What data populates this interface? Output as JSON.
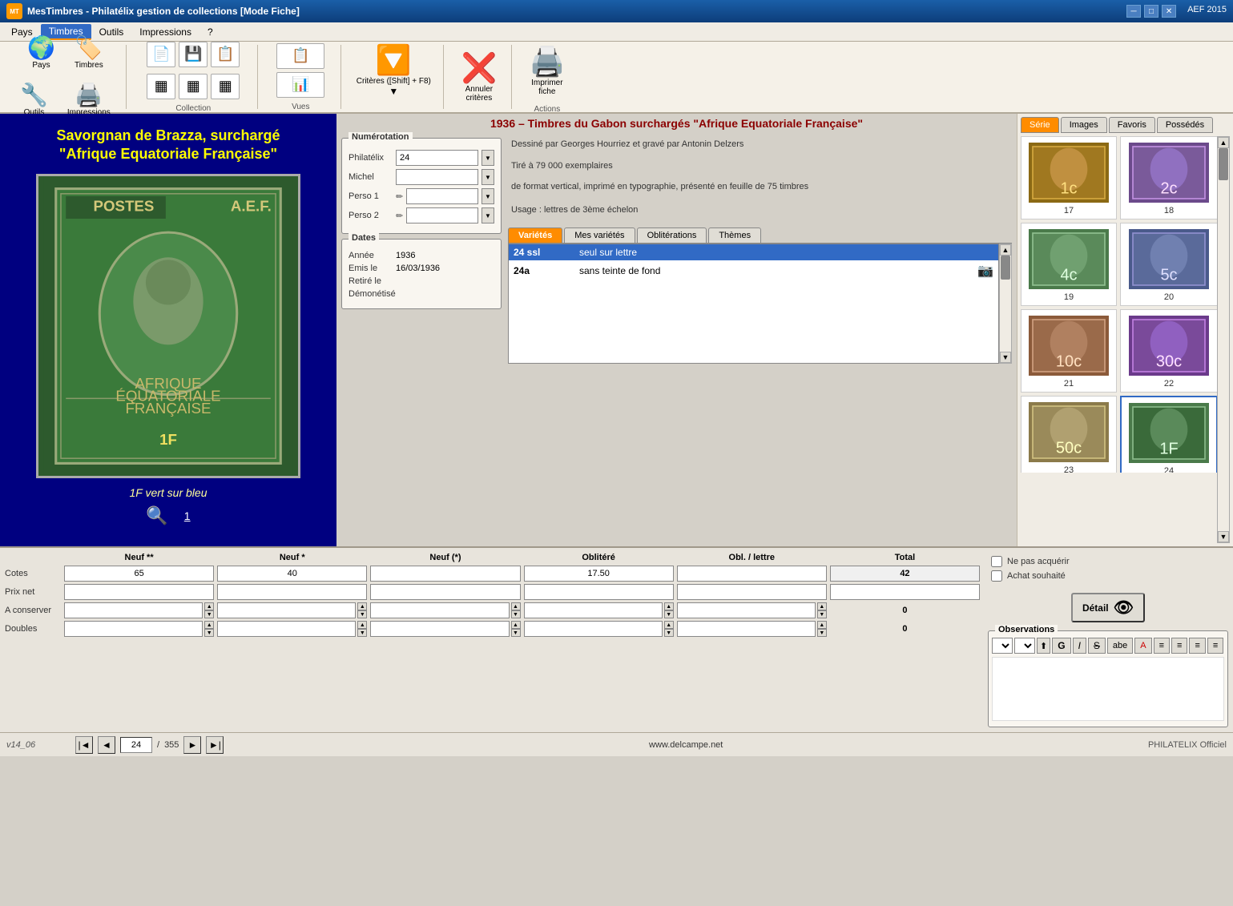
{
  "titleBar": {
    "appName": "MesTimbres - Philatélix gestion de collections [Mode Fiche]",
    "version": "AEF 2015",
    "minimizeBtn": "─",
    "maximizeBtn": "□",
    "closeBtn": "✕"
  },
  "menuBar": {
    "items": [
      "Pays",
      "Timbres",
      "Outils",
      "Impressions",
      "?"
    ],
    "activeItem": "Timbres"
  },
  "toolbar": {
    "sections": [
      {
        "name": "nav",
        "buttons": [
          {
            "id": "pays",
            "icon": "🌍",
            "label": "Pays"
          },
          {
            "id": "timbres",
            "icon": "🏷️",
            "label": "Timbres"
          },
          {
            "id": "outils",
            "icon": "🔧",
            "label": "Outils"
          },
          {
            "id": "impressions",
            "icon": "🖨️",
            "label": "Impressions"
          }
        ],
        "sectionLabel": ""
      }
    ],
    "collection": {
      "label": "Collection"
    },
    "vues": {
      "label": "Vues"
    },
    "criteres": {
      "label": "Critères ([Shift] + F8)",
      "sublabel": "▼"
    },
    "annuler": {
      "label": "Annuler\ncritères"
    },
    "imprimer": {
      "label": "Imprimer\nfiche"
    },
    "actions": {
      "label": "Actions"
    }
  },
  "stampPanel": {
    "title": "Savorgnan de Brazza, surchargé\n\"Afrique Equatoriale Française\"",
    "subtitle": "1F vert sur bleu",
    "stampNumber": "1"
  },
  "seriesTitle": "1936 – Timbres du Gabon surchargés \"Afrique Equatoriale Française\"",
  "numerotation": {
    "legend": "Numérotation",
    "fields": [
      {
        "label": "Philatélix",
        "value": "24",
        "hasDropdown": true,
        "hasPencil": false
      },
      {
        "label": "Michel",
        "value": "",
        "hasDropdown": true,
        "hasPencil": false
      },
      {
        "label": "Perso 1",
        "value": "",
        "hasDropdown": true,
        "hasPencil": true
      },
      {
        "label": "Perso 2",
        "value": "",
        "hasDropdown": true,
        "hasPencil": true
      }
    ]
  },
  "dates": {
    "legend": "Dates",
    "fields": [
      {
        "label": "Année",
        "value": "1936"
      },
      {
        "label": "Emis le",
        "value": "16/03/1936"
      },
      {
        "label": "Retiré le",
        "value": ""
      },
      {
        "label": "Démonétisé",
        "value": ""
      }
    ]
  },
  "description": {
    "lines": [
      "Dessiné par Georges Hourriez et gravé par Antonin Delzers",
      "",
      "Tiré à 79 000 exemplaires",
      "",
      "de format vertical, imprimé en typographie, présenté en feuille de 75 timbres",
      "",
      "Usage : lettres de 3ème échelon"
    ]
  },
  "varietiesTabs": [
    "Variétés",
    "Mes variétés",
    "Oblitérations",
    "Thèmes"
  ],
  "activeVarietyTab": "Variétés",
  "varieties": [
    {
      "code": "24 ssl",
      "description": "seul sur lettre",
      "hasImage": false,
      "selected": true
    },
    {
      "code": "24a",
      "description": "sans teinte de fond",
      "hasImage": true,
      "selected": false
    }
  ],
  "thumbTabs": [
    "Série",
    "Images",
    "Favoris",
    "Possédés"
  ],
  "activeThumbTab": "Série",
  "thumbnails": [
    {
      "number": "17",
      "color": "#8B6914"
    },
    {
      "number": "18",
      "color": "#6B4A8B"
    },
    {
      "number": "19",
      "color": "#4A7A4A"
    },
    {
      "number": "20",
      "color": "#4A5A8B"
    },
    {
      "number": "21",
      "color": "#8B5A3A"
    },
    {
      "number": "22",
      "color": "#6B3A8B"
    },
    {
      "number": "23",
      "color": "#8B7A4A"
    },
    {
      "number": "24",
      "color": "#4A7A4A"
    }
  ],
  "statsHeaders": [
    "Neuf **",
    "Neuf *",
    "Neuf (*)",
    "Oblitéré",
    "Obl. / lettre",
    "Total"
  ],
  "statsRows": [
    {
      "label": "Cotes",
      "values": [
        "65",
        "40",
        "",
        "17.50",
        "",
        "42"
      ],
      "total": "42"
    },
    {
      "label": "Prix net",
      "values": [
        "",
        "",
        "",
        "",
        "",
        ""
      ],
      "total": ""
    },
    {
      "label": "A conserver",
      "values": [
        "",
        "",
        "",
        "",
        "",
        "0"
      ],
      "total": "0",
      "isSpinner": true
    },
    {
      "label": "Doubles",
      "values": [
        "",
        "",
        "",
        "",
        "",
        "0"
      ],
      "total": "0",
      "isSpinner": true
    }
  ],
  "checkboxes": [
    {
      "label": "Ne pas acquérir",
      "checked": false
    },
    {
      "label": "Achat souhaité",
      "checked": false
    }
  ],
  "detailBtn": "Détail",
  "observations": {
    "legend": "Observations",
    "toolbarBtns": [
      "G",
      "I",
      "S",
      "abe",
      "A"
    ],
    "alignBtns": [
      "≡",
      "≡",
      "≡",
      "≡"
    ]
  },
  "navigation": {
    "version": "v14_06",
    "current": "24",
    "total": "355",
    "website": "www.delcampe.net",
    "credit": "PHILATELIX Officiel"
  }
}
